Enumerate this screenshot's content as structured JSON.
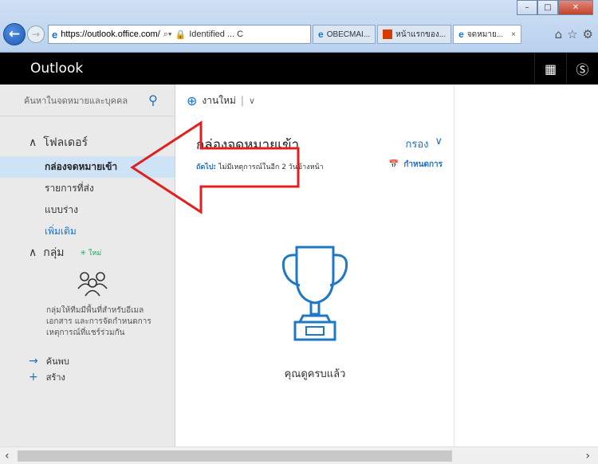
{
  "browser": {
    "url": "https://outlook.office.com/",
    "url_tail": "Ꝋ ▾",
    "identified": "Identified ... C",
    "tabs": [
      {
        "label": "OBECMAI..."
      },
      {
        "label": "หน้าแรกของ..."
      },
      {
        "label": "จดหมาย...",
        "close": "×"
      }
    ]
  },
  "header": {
    "title": "Outlook"
  },
  "search": {
    "placeholder": "ค้นหาในจดหมายและบุคคล"
  },
  "folders": {
    "heading": "โฟลเดอร์",
    "items": [
      {
        "label": "กล่องจดหมายเข้า"
      },
      {
        "label": "รายการที่ส่ง"
      },
      {
        "label": "แบบร่าง"
      }
    ],
    "more": "เพิ่มเติม"
  },
  "groups": {
    "heading": "กลุ่ม",
    "new_badge": "✳ ใหม่",
    "description": "กลุ่มให้ทีมมีพื้นที่สำหรับอีเมล เอกสาร และการจัดกำหนดการ เหตุการณ์ที่แชร์ร่วมกัน",
    "discover": "ค้นพบ",
    "create": "สร้าง"
  },
  "toolbar": {
    "new_label": "งานใหม่"
  },
  "list": {
    "title": "กล่องจดหมายเข้า",
    "filter": "กรอง",
    "next_label": "ถัดไป:",
    "next_text": "ไม่มีเหตุการณ์ในอีก 2 วันข้างหน้า",
    "agenda": "กำหนดการ",
    "empty_message": "คุณดูครบแล้ว"
  }
}
